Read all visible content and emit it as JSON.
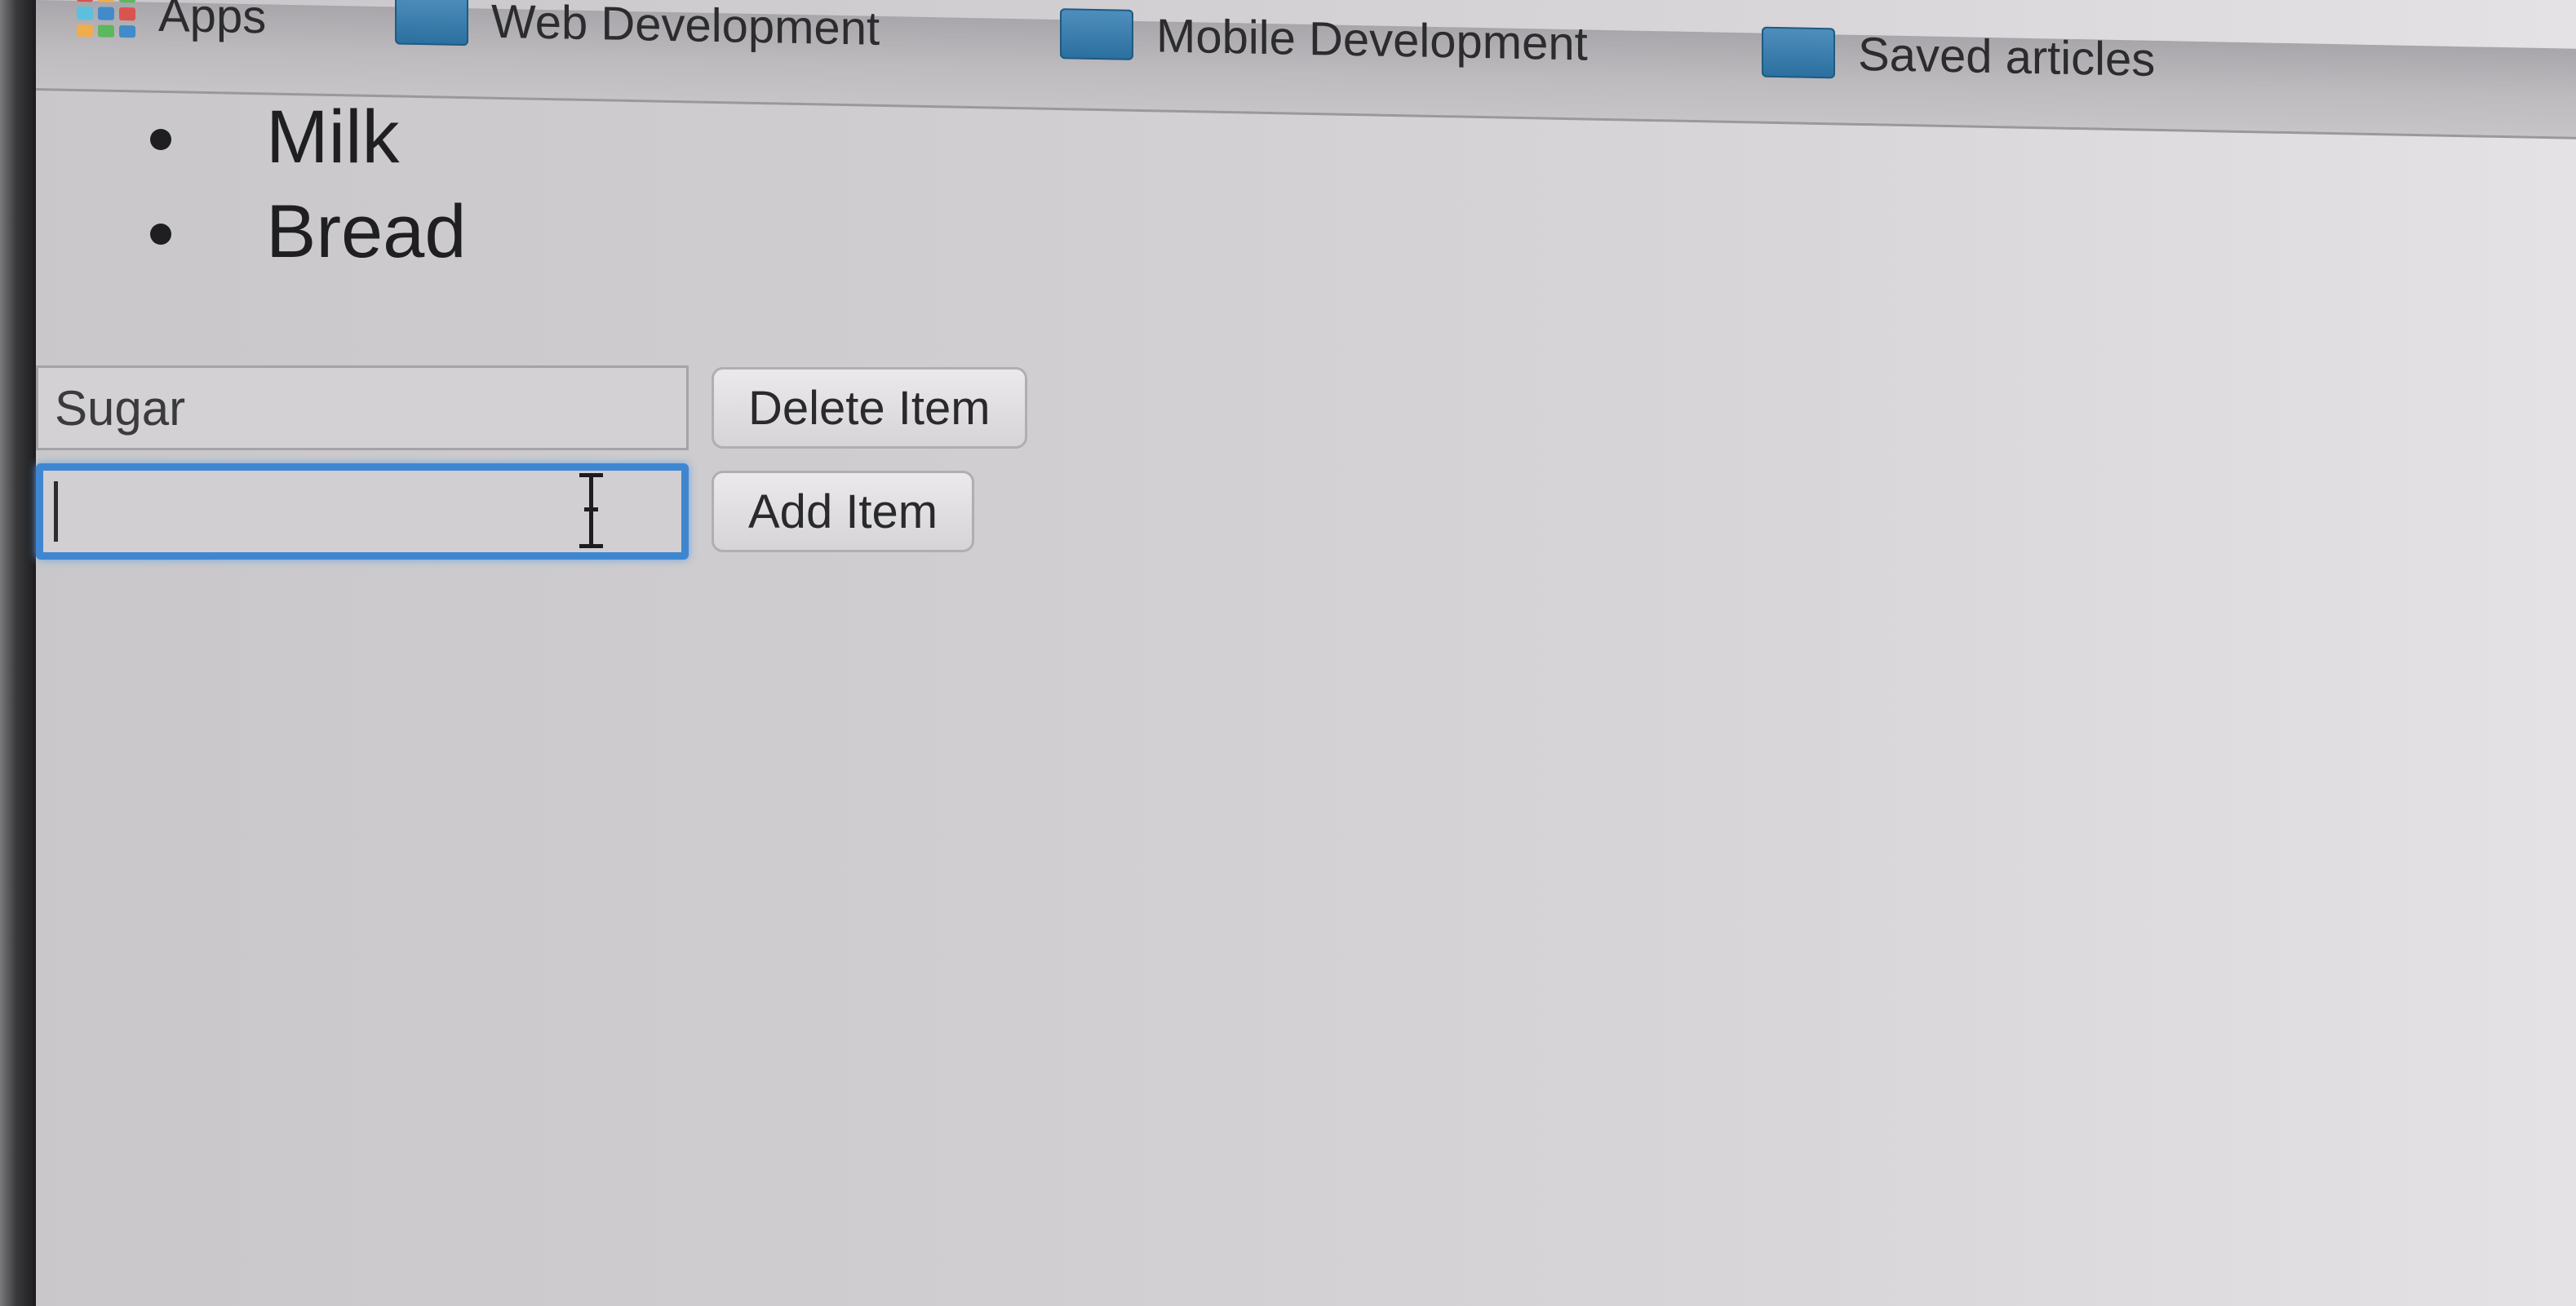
{
  "bookmarks": {
    "items": [
      {
        "label": "Apps",
        "icon": "apps-grid-icon"
      },
      {
        "label": "Web Development",
        "icon": "folder-icon"
      },
      {
        "label": "Mobile Development",
        "icon": "folder-icon"
      },
      {
        "label": "Saved articles",
        "icon": "folder-icon"
      }
    ]
  },
  "list": {
    "items": [
      "Milk",
      "Bread"
    ]
  },
  "form": {
    "delete_input_value": "Sugar",
    "delete_button_label": "Delete Item",
    "add_input_value": "",
    "add_button_label": "Add Item"
  },
  "colors": {
    "focus_ring": "#3f86d1",
    "folder_blue": "#2a6f9e",
    "apps_grid": [
      "#d9534f",
      "#f0ad4e",
      "#5cb85c",
      "#5bc0de",
      "#428bca",
      "#d9534f",
      "#f0ad4e",
      "#5cb85c",
      "#428bca"
    ]
  }
}
